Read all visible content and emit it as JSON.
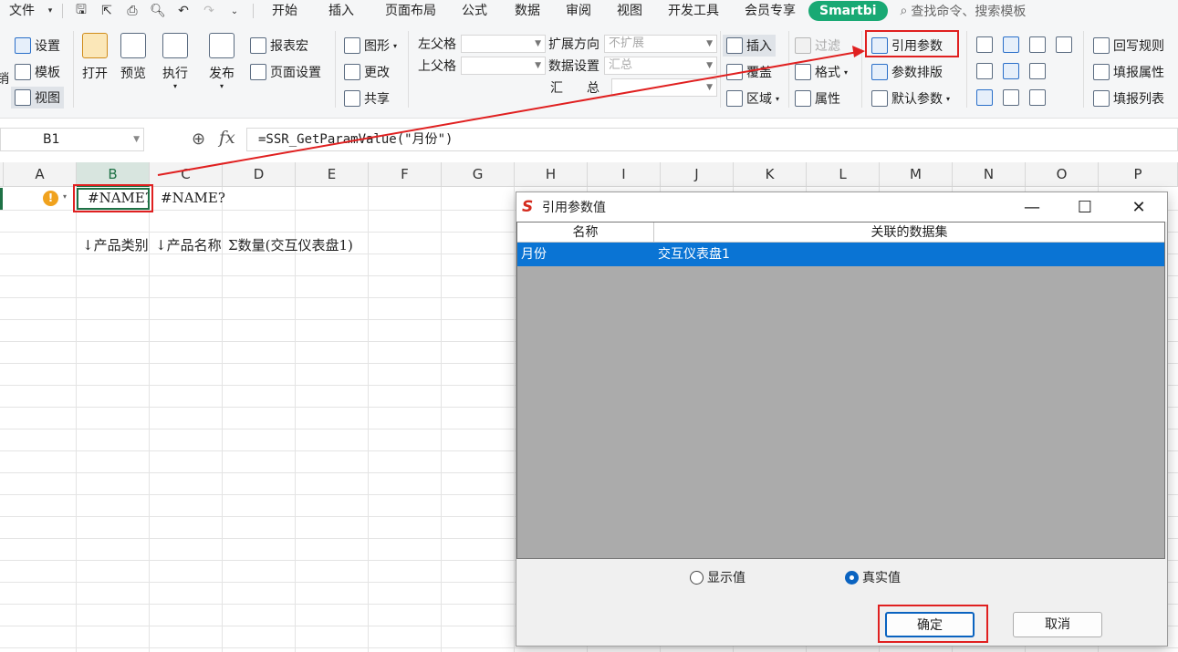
{
  "menubar": {
    "file": "文件",
    "tabs": [
      "开始",
      "插入",
      "页面布局",
      "公式",
      "数据",
      "审阅",
      "视图",
      "开发工具",
      "会员专享"
    ],
    "smartbi_tab": "Smartbi",
    "search_placeholder": "查找命令、搜索模板"
  },
  "ribbon": {
    "cut_label": "销",
    "settings": "设置",
    "template": "模板",
    "view": "视图",
    "open": "打开",
    "preview": "预览",
    "execute": "执行",
    "publish": "发布",
    "report_macro": "报表宏",
    "page_setup": "页面设置",
    "chart": "图形",
    "change": "更改",
    "share": "共享",
    "left_parent": "左父格",
    "upper_parent": "上父格",
    "expand_dir": "扩展方向",
    "expand_dir_value": "不扩展",
    "data_setting": "数据设置",
    "data_setting_value": "汇总",
    "summary_1": "汇",
    "summary_2": "总",
    "insert": "插入",
    "cover": "覆盖",
    "area": "区域",
    "filter": "过滤",
    "format": "格式",
    "properties": "属性",
    "ref_param": "引用参数",
    "param_layout": "参数排版",
    "default_param": "默认参数",
    "writeback_rule": "回写规则",
    "fill_property": "填报属性",
    "fill_list": "填报列表"
  },
  "formula_bar": {
    "cell_ref": "B1",
    "formula": "=SSR_GetParamValue(\"月份\")"
  },
  "sheet": {
    "columns": [
      "A",
      "B",
      "C",
      "D",
      "E",
      "F",
      "G",
      "H",
      "I",
      "J",
      "K",
      "L",
      "M",
      "N",
      "O",
      "P"
    ],
    "b1": "#NAME?",
    "c1": "#NAME?",
    "b3": "↓产品类别",
    "c3": "↓产品名称",
    "d3": "Σ数量(交互仪表盘1)"
  },
  "dialog": {
    "title": "引用参数值",
    "col_name": "名称",
    "col_dataset": "关联的数据集",
    "rows": [
      {
        "name": "月份",
        "dataset": "交互仪表盘1"
      }
    ],
    "radio_display": "显示值",
    "radio_real": "真实值",
    "radio_selected": "real",
    "ok": "确定",
    "cancel": "取消"
  },
  "colors": {
    "smartbi_green": "#19a974",
    "selection_blue": "#0a74d4",
    "highlight_red": "#e02020"
  }
}
